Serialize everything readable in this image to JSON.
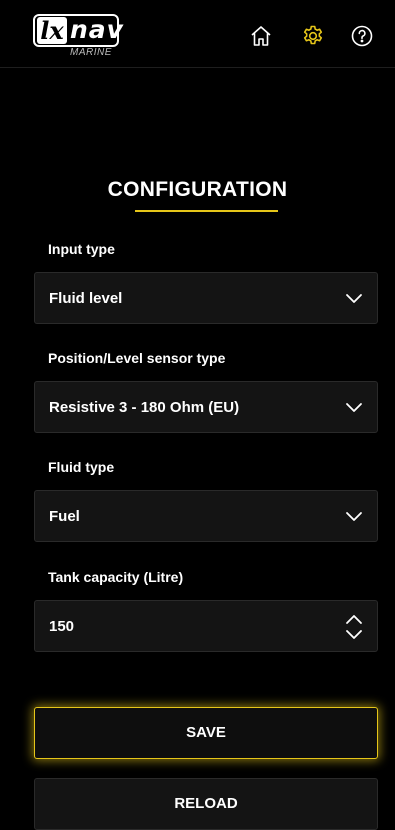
{
  "header": {
    "logo": {
      "lx": "lx",
      "nav": "nav",
      "marine": "MARINE"
    },
    "icons": {
      "home": "home-icon",
      "settings": "gear-icon",
      "help": "help-icon"
    },
    "accent": "#e6c619"
  },
  "page": {
    "title": "CONFIGURATION"
  },
  "form": {
    "input_type": {
      "label": "Input type",
      "value": "Fluid level"
    },
    "sensor_type": {
      "label": "Position/Level sensor type",
      "value": "Resistive 3 - 180 Ohm (EU)"
    },
    "fluid_type": {
      "label": "Fluid type",
      "value": "Fuel"
    },
    "tank_capacity": {
      "label": "Tank capacity (Litre)",
      "value": "150"
    }
  },
  "actions": {
    "save": "SAVE",
    "reload": "RELOAD"
  }
}
